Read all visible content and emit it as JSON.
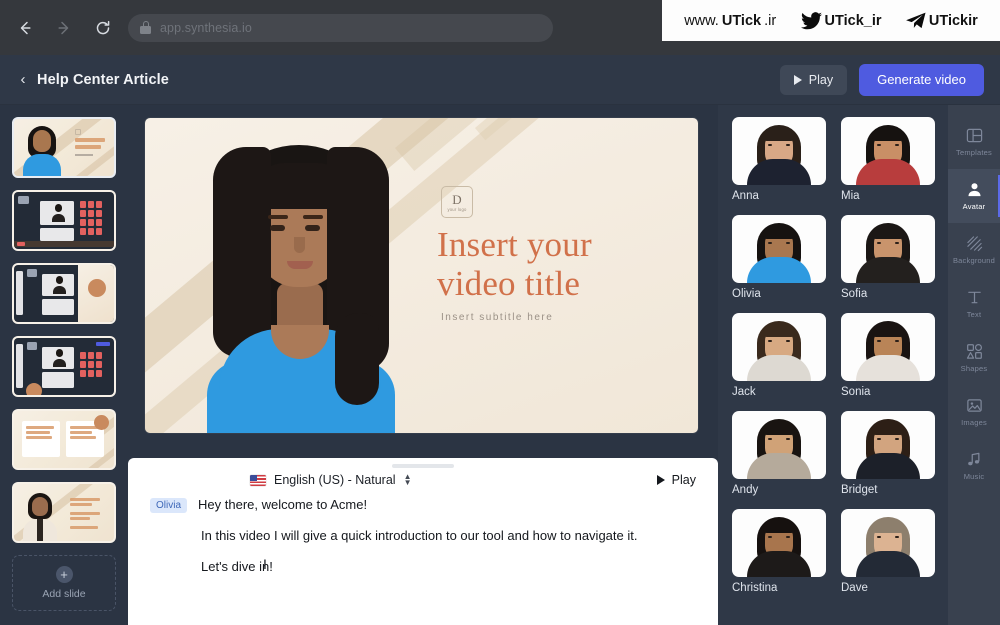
{
  "browser": {
    "url": "app.synthesia.io",
    "nav": {
      "back": "back-arrow",
      "forward": "forward-arrow",
      "reload": "reload"
    }
  },
  "watermark": [
    {
      "light": "www.",
      "bold": "UTick",
      "tail": ".ir",
      "icon": "globe"
    },
    {
      "light": "",
      "bold": "UTick_ir",
      "tail": "",
      "icon": "twitter-bird"
    },
    {
      "light": "",
      "bold": "UTickir",
      "tail": "",
      "icon": "telegram-plane"
    }
  ],
  "header": {
    "title": "Help Center Article",
    "back_label": "‹",
    "play_label": "Play",
    "generate_label": "Generate video",
    "generate_color": "#4f5be0"
  },
  "slides": {
    "add_slide_label": "Add slide",
    "items": [
      {
        "name": "slide-1-title",
        "selected": true
      },
      {
        "name": "slide-2-ui-grid",
        "selected": false
      },
      {
        "name": "slide-3-ui-avatar",
        "selected": false
      },
      {
        "name": "slide-4-ui-grid",
        "selected": false
      },
      {
        "name": "slide-5-two-column",
        "selected": false
      },
      {
        "name": "slide-6-bullets",
        "selected": false
      }
    ]
  },
  "canvas": {
    "logo_mark": "D",
    "logo_text": "your logo",
    "title_line1": "Insert your",
    "title_line2": "video title",
    "subtitle": "Insert subtitle here",
    "title_color": "#d1714a",
    "background_color": "#f5ece0"
  },
  "script": {
    "language": "English (US) - Natural",
    "language_flag": "us-flag",
    "play_label": "Play",
    "speaker": "Olivia",
    "lines": [
      "Hey there, welcome to Acme!",
      "In this video I will give a quick introduction to our tool and how to navigate it.",
      "Let's dive in!"
    ]
  },
  "avatars": [
    {
      "name": "Anna",
      "skin": "#d8a886",
      "hair": "#2a2019",
      "outfit": "#1d2230"
    },
    {
      "name": "Mia",
      "skin": "#c98f66",
      "hair": "#161210",
      "outfit": "#b83d3d"
    },
    {
      "name": "Olivia",
      "skin": "#a9774f",
      "hair": "#161210",
      "outfit": "#2f9ae0"
    },
    {
      "name": "Sofia",
      "skin": "#c9946c",
      "hair": "#1b1715",
      "outfit": "#23201e"
    },
    {
      "name": "Jack",
      "skin": "#d7a982",
      "hair": "#3a2a1d",
      "outfit": "#ddd9d2"
    },
    {
      "name": "Sonia",
      "skin": "#b98457",
      "hair": "#1a1412",
      "outfit": "#e6e1db"
    },
    {
      "name": "Andy",
      "skin": "#d0a277",
      "hair": "#191411",
      "outfit": "#b5aa9b"
    },
    {
      "name": "Bridget",
      "skin": "#d2a47f",
      "hair": "#2d1f16",
      "outfit": "#1c2029"
    },
    {
      "name": "Christina",
      "skin": "#a8754d",
      "hair": "#16110f",
      "outfit": "#1d1a19"
    },
    {
      "name": "Dave",
      "skin": "#dcb392",
      "hair": "#8d7f6d",
      "outfit": "#232a36"
    }
  ],
  "tools": [
    {
      "label": "Templates",
      "icon": "templates-icon",
      "active": false
    },
    {
      "label": "Avatar",
      "icon": "avatar-icon",
      "active": true
    },
    {
      "label": "Background",
      "icon": "background-icon",
      "active": false
    },
    {
      "label": "Text",
      "icon": "text-icon",
      "active": false
    },
    {
      "label": "Shapes",
      "icon": "shapes-icon",
      "active": false
    },
    {
      "label": "Images",
      "icon": "images-icon",
      "active": false
    },
    {
      "label": "Music",
      "icon": "music-icon",
      "active": false
    }
  ]
}
